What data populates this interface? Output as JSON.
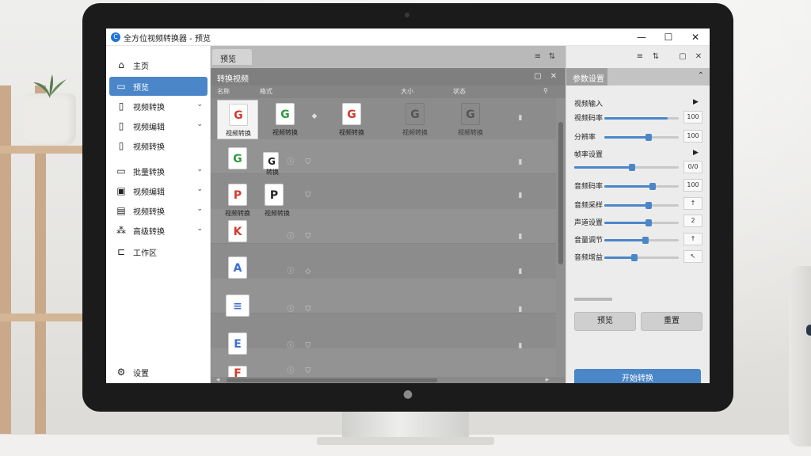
{
  "window": {
    "title": "全方位视频转换器 - 预览",
    "app_icon": "app-logo-icon",
    "controls": [
      "minimize-icon",
      "maximize-icon",
      "close-icon"
    ]
  },
  "sidebar": {
    "items": [
      {
        "label": "主页",
        "icon": "home-icon",
        "active": false,
        "chevron": false
      },
      {
        "label": "预览",
        "icon": "folder-icon",
        "active": true,
        "chevron": false
      },
      {
        "label": "视频转换",
        "icon": "video-file-icon",
        "active": false,
        "chevron": true
      },
      {
        "label": "视频编辑",
        "icon": "file-icon",
        "active": false,
        "chevron": true
      },
      {
        "label": "视频转换",
        "icon": "file-icon",
        "active": false,
        "chevron": false
      },
      {
        "label": "批量转换",
        "icon": "folder-icon",
        "active": false,
        "chevron": true
      },
      {
        "label": "视频编辑",
        "icon": "image-icon",
        "active": false,
        "chevron": true
      },
      {
        "label": "视频转换",
        "icon": "film-icon",
        "active": false,
        "chevron": true
      },
      {
        "label": "高级转换",
        "icon": "apps-icon",
        "active": false,
        "chevron": true
      },
      {
        "label": "工作区",
        "icon": "folder-outline-icon",
        "active": false,
        "chevron": false
      }
    ],
    "footer_label": "设置",
    "footer_icon": "gear-icon"
  },
  "center": {
    "tab_label": "预览",
    "list_title": "转换视频",
    "column_headers": [
      "名称",
      "格式",
      "大小",
      "状态"
    ],
    "files_row1": [
      {
        "label": "视频转换",
        "glyph": "G",
        "glyph_color": "#d23b2e",
        "selected": true,
        "faded": false
      },
      {
        "label": "视频转换",
        "glyph": "G",
        "glyph_color": "#2e9a3d",
        "selected": false,
        "faded": false
      },
      {
        "label": "视频转换",
        "glyph": "G",
        "glyph_color": "#d23b2e",
        "selected": false,
        "faded": false
      },
      {
        "label": "视频转换",
        "glyph": "G",
        "glyph_color": "#555555",
        "selected": false,
        "faded": true
      },
      {
        "label": "视频转换",
        "glyph": "G",
        "glyph_color": "#555555",
        "selected": false,
        "faded": true
      }
    ],
    "files_col": [
      {
        "label": "",
        "glyph": "G",
        "glyph_color": "#2e9a3d"
      },
      {
        "label": "视频转换",
        "glyph": "P",
        "glyph_color": "#d23b2e"
      },
      {
        "label": "",
        "glyph": "K",
        "glyph_color": "#d23b2e"
      },
      {
        "label": "",
        "glyph": "A",
        "glyph_color": "#3b6fd1"
      },
      {
        "label": "",
        "glyph": "≡",
        "glyph_color": "#3b6fd1"
      },
      {
        "label": "",
        "glyph": "E",
        "glyph_color": "#3b6fd1"
      },
      {
        "label": "",
        "glyph": "F",
        "glyph_color": "#d23b2e"
      }
    ],
    "files_col2": [
      {
        "label": "",
        "glyph": "G",
        "glyph_color": "#222222"
      },
      {
        "label": "视频转换",
        "glyph": "P",
        "glyph_color": "#222222"
      }
    ],
    "row_tag": "转换"
  },
  "right": {
    "panel_title": "参数设置",
    "rows": [
      {
        "label": "视频输入",
        "type": "arrow"
      },
      {
        "label": "视频码率",
        "type": "slider",
        "fill": 0.85,
        "value": "100"
      },
      {
        "label": "分辨率",
        "type": "slider",
        "fill": 0.6,
        "value": "100"
      },
      {
        "label": "帧率设置",
        "type": "arrow"
      },
      {
        "label": "",
        "type": "slider-wide",
        "fill": 0.55,
        "value": "0/0"
      },
      {
        "label": "音频码率",
        "type": "slider",
        "fill": 0.65,
        "value": "100"
      },
      {
        "label": "音频采样",
        "type": "slider",
        "fill": 0.6,
        "value": "↑"
      },
      {
        "label": "声道设置",
        "type": "slider",
        "fill": 0.6,
        "value": "2"
      },
      {
        "label": "音量调节",
        "type": "slider",
        "fill": 0.55,
        "value": "↑"
      },
      {
        "label": "音频增益",
        "type": "slider",
        "fill": 0.4,
        "value": "↖"
      }
    ],
    "buttons": [
      "预览",
      "重置"
    ],
    "primary_button": "开始转换"
  }
}
